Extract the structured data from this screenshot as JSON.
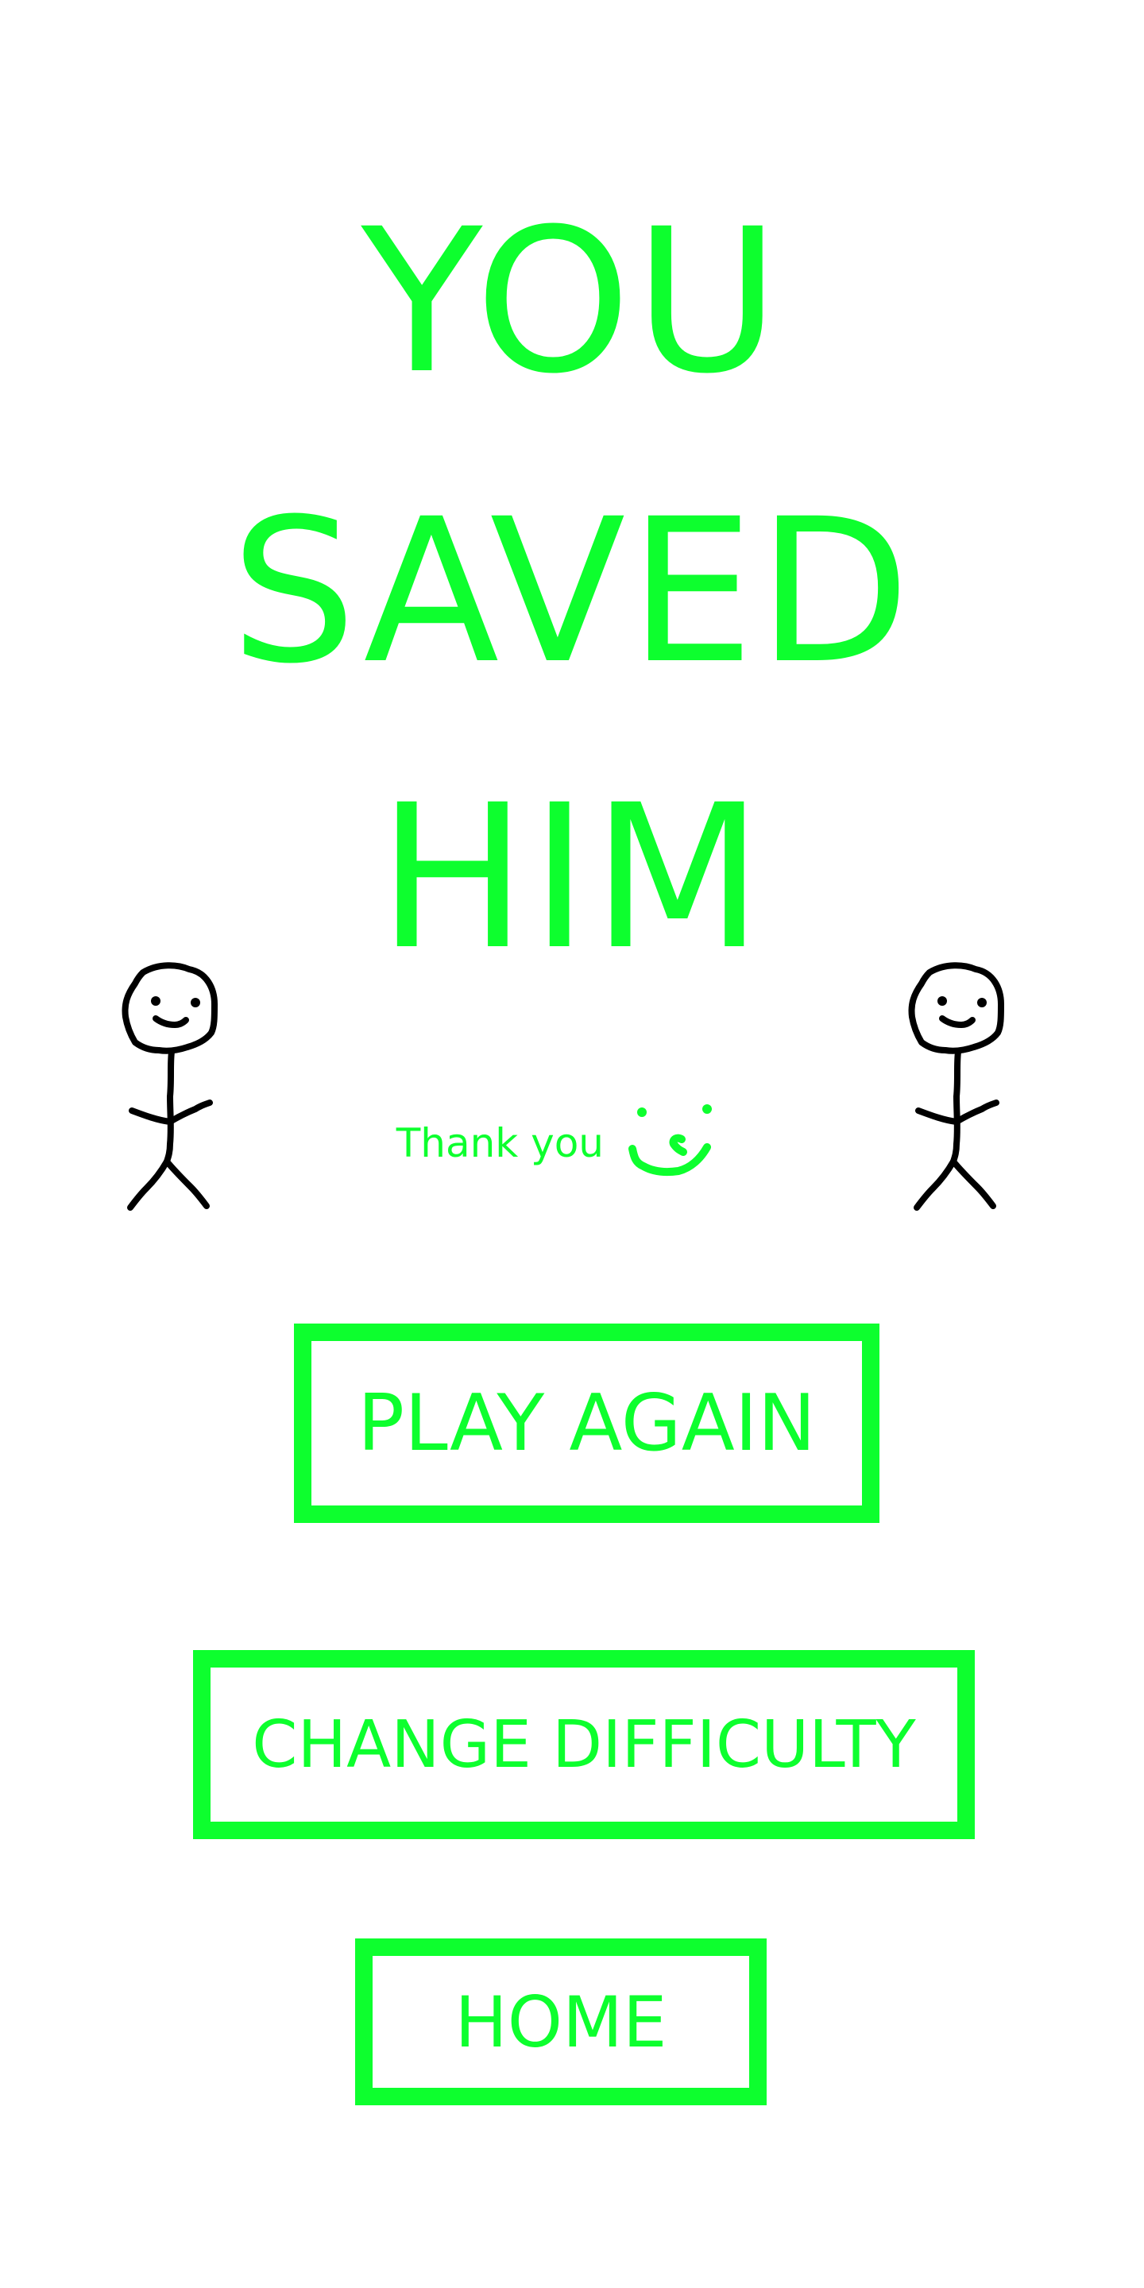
{
  "screen": {
    "title_lines": [
      "YOU",
      "SAVED",
      "HIM"
    ],
    "thanks_text": "Thank you"
  },
  "buttons": {
    "play_again": "PLAY AGAIN",
    "change_difficulty": "CHANGE DIFFICULTY",
    "home": "HOME"
  },
  "colors": {
    "accent": "#0dff2e",
    "figure": "#000000",
    "background": "#ffffff"
  },
  "icons": {
    "figures": "stick-figure-icon",
    "smile": "smiley-face-icon"
  }
}
